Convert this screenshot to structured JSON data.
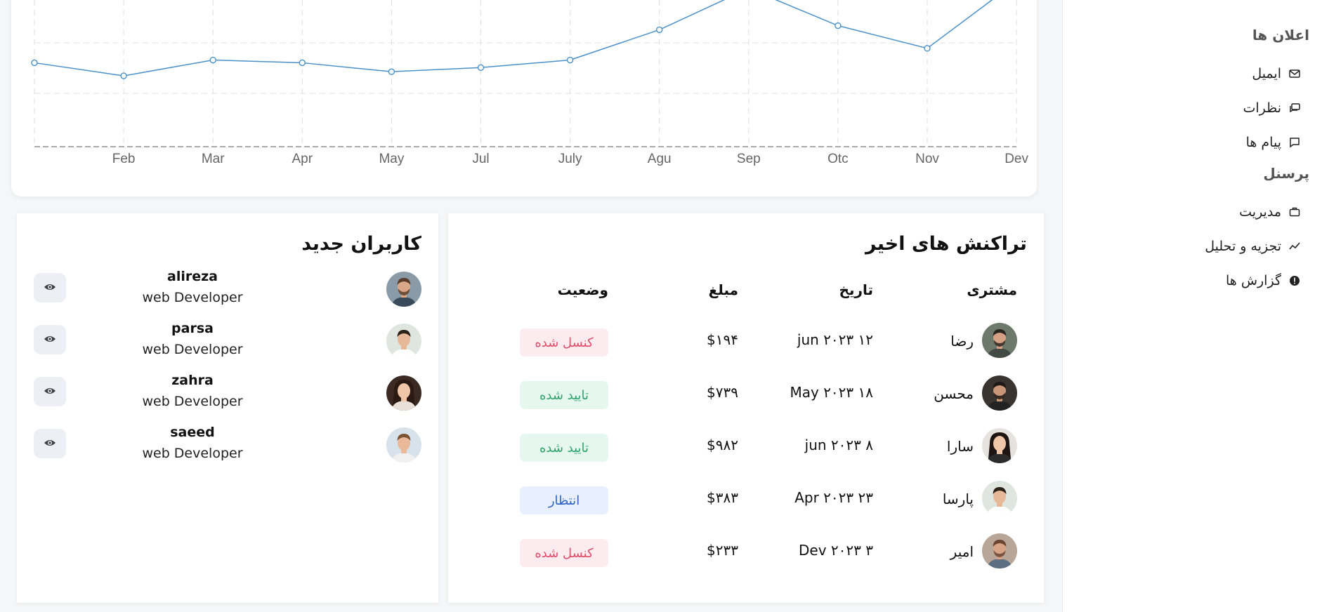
{
  "sidebar": {
    "sections": [
      {
        "heading": "اعلان ها",
        "items": [
          {
            "label": "ایمیل",
            "icon": "mail-icon"
          },
          {
            "label": "نظرات",
            "icon": "comments-icon"
          },
          {
            "label": "پیام ها",
            "icon": "message-icon"
          }
        ]
      },
      {
        "heading": "پرسنل",
        "items": [
          {
            "label": "مدیریت",
            "icon": "briefcase-icon"
          },
          {
            "label": "تجزیه و تحلیل",
            "icon": "trend-icon"
          },
          {
            "label": "گزارش ها",
            "icon": "alert-circle-icon"
          }
        ]
      }
    ]
  },
  "chart_data": {
    "type": "line",
    "categories": [
      "",
      "Feb",
      "Mar",
      "Apr",
      "May",
      "Jul",
      "July",
      "Agu",
      "Sep",
      "Otc",
      "Nov",
      "Dev"
    ],
    "series": [
      {
        "values": [
          122,
          103,
          126,
          122,
          109,
          115,
          126,
          170,
          230,
          176,
          143,
          240
        ]
      }
    ],
    "ylim": [
      0,
      200
    ],
    "grid": true,
    "line_color": "#4a90c9"
  },
  "users": {
    "title": "کاربران جدید",
    "list": [
      {
        "name": "alireza",
        "role": "web Developer",
        "avatar": "avatar-man-beard"
      },
      {
        "name": "parsa",
        "role": "web Developer",
        "avatar": "avatar-man-smile"
      },
      {
        "name": "zahra",
        "role": "web Developer",
        "avatar": "avatar-woman"
      },
      {
        "name": "saeed",
        "role": "web Developer",
        "avatar": "avatar-man-young"
      }
    ]
  },
  "transactions": {
    "title": "تراکنش های اخیر",
    "columns": {
      "customer": "مشتری",
      "date": "تاریخ",
      "amount": "مبلغ",
      "status": "وضعیت"
    },
    "rows": [
      {
        "customer": "رضا",
        "date": "jun ۲۰۲۳ ۱۲",
        "amount": "$۱۹۴",
        "status": "کنسل شده",
        "status_type": "cancel"
      },
      {
        "customer": "محسن",
        "date": "May ۲۰۲۳ ۱۸",
        "amount": "$۷۳۹",
        "status": "تایید شده",
        "status_type": "ok"
      },
      {
        "customer": "سارا",
        "date": "jun ۲۰۲۳ ۸",
        "amount": "$۹۸۲",
        "status": "تایید شده",
        "status_type": "ok"
      },
      {
        "customer": "پارسا",
        "date": "Apr ۲۰۲۳ ۲۳",
        "amount": "$۳۸۳",
        "status": "انتظار",
        "status_type": "wait"
      },
      {
        "customer": "امیر",
        "date": "Dev ۲۰۲۳ ۳",
        "amount": "$۲۳۳",
        "status": "کنسل شده",
        "status_type": "cancel"
      }
    ]
  }
}
